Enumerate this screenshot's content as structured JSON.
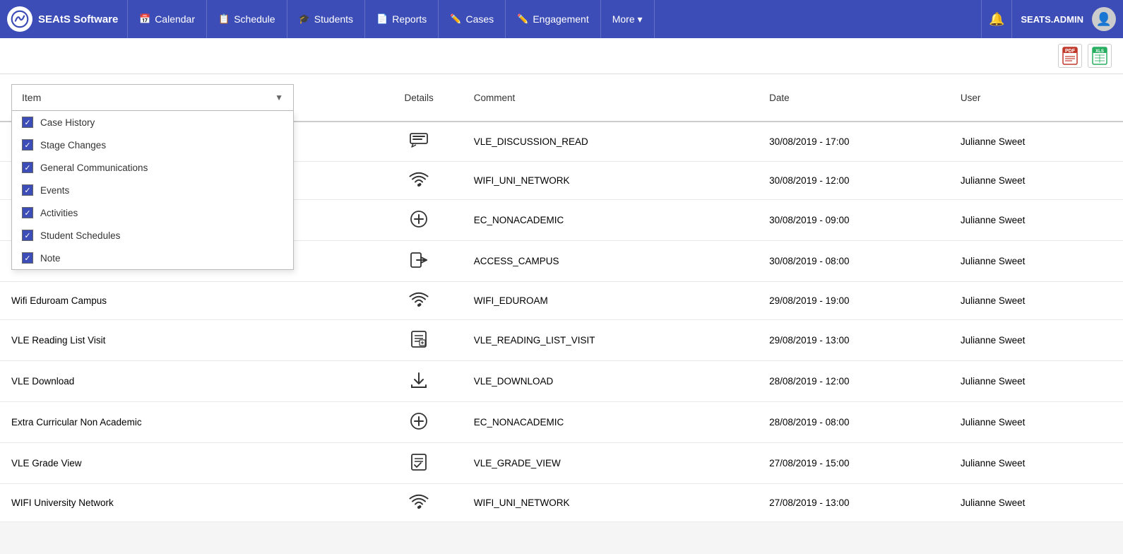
{
  "app": {
    "brand": "SEAtS Software",
    "admin_label": "SEATS.ADMIN"
  },
  "nav": {
    "items": [
      {
        "label": "Calendar",
        "icon": "📅"
      },
      {
        "label": "Schedule",
        "icon": "📋"
      },
      {
        "label": "Students",
        "icon": "🎓"
      },
      {
        "label": "Reports",
        "icon": "📄"
      },
      {
        "label": "Cases",
        "icon": "✏️"
      },
      {
        "label": "Engagement",
        "icon": "✏️"
      },
      {
        "label": "More ▾",
        "icon": ""
      }
    ]
  },
  "toolbar": {
    "pdf_title": "Export PDF",
    "excel_title": "Export Excel"
  },
  "filter": {
    "label": "Item",
    "dropdown_items": [
      "Case History",
      "Stage Changes",
      "General Communications",
      "Events",
      "Activities",
      "Student Schedules",
      "Note"
    ]
  },
  "table": {
    "columns": [
      "Item",
      "Details",
      "Comment",
      "Date",
      "User"
    ],
    "rows": [
      {
        "item": "",
        "icon": "discussion",
        "comment": "VLE_DISCUSSION_READ",
        "date": "30/08/2019 - 17:00",
        "user": "Julianne Sweet"
      },
      {
        "item": "",
        "icon": "wifi",
        "comment": "WIFI_UNI_NETWORK",
        "date": "30/08/2019 - 12:00",
        "user": "Julianne Sweet"
      },
      {
        "item": "",
        "icon": "plus-circle",
        "comment": "EC_NONACADEMIC",
        "date": "30/08/2019 - 09:00",
        "user": "Julianne Sweet"
      },
      {
        "item": "",
        "icon": "sign-in",
        "comment": "ACCESS_CAMPUS",
        "date": "30/08/2019 - 08:00",
        "user": "Julianne Sweet"
      },
      {
        "item": "Wifi Eduroam Campus",
        "icon": "wifi",
        "comment": "WIFI_EDUROAM",
        "date": "29/08/2019 - 19:00",
        "user": "Julianne Sweet"
      },
      {
        "item": "VLE Reading List Visit",
        "icon": "reading-list",
        "comment": "VLE_READING_LIST_VISIT",
        "date": "29/08/2019 - 13:00",
        "user": "Julianne Sweet"
      },
      {
        "item": "VLE Download",
        "icon": "download",
        "comment": "VLE_DOWNLOAD",
        "date": "28/08/2019 - 12:00",
        "user": "Julianne Sweet"
      },
      {
        "item": "Extra Curricular Non Academic",
        "icon": "plus-circle",
        "comment": "EC_NONACADEMIC",
        "date": "28/08/2019 - 08:00",
        "user": "Julianne Sweet"
      },
      {
        "item": "VLE Grade View",
        "icon": "grade",
        "comment": "VLE_GRADE_VIEW",
        "date": "27/08/2019 - 15:00",
        "user": "Julianne Sweet"
      },
      {
        "item": "WIFI University Network",
        "icon": "wifi",
        "comment": "WIFI_UNI_NETWORK",
        "date": "27/08/2019 - 13:00",
        "user": "Julianne Sweet"
      }
    ]
  }
}
